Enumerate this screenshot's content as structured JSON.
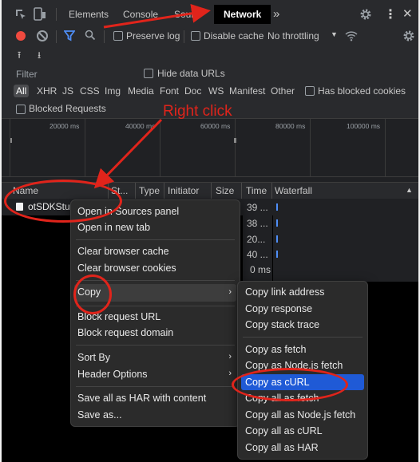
{
  "tabs": {
    "elements": "Elements",
    "console": "Console",
    "sources": "Sour",
    "network": "Network",
    "more": "»"
  },
  "toolbar": {
    "preserve_log": "Preserve log",
    "disable_cache": "Disable cache",
    "throttling": "No throttling"
  },
  "filter": {
    "placeholder": "Filter",
    "hide_data_urls": "Hide data URLs",
    "types": [
      "All",
      "XHR",
      "JS",
      "CSS",
      "Img",
      "Media",
      "Font",
      "Doc",
      "WS",
      "Manifest",
      "Other"
    ],
    "has_blocked_cookies": "Has blocked cookies",
    "blocked_requests": "Blocked Requests"
  },
  "timeline": {
    "ticks": [
      "20000 ms",
      "40000 ms",
      "60000 ms",
      "80000 ms",
      "100000 ms"
    ]
  },
  "table": {
    "headers": {
      "name": "Name",
      "status": "St...",
      "type": "Type",
      "initiator": "Initiator",
      "size": "Size",
      "time": "Time",
      "waterfall": "Waterfall"
    },
    "row_name": "otSDKStu",
    "times": [
      "39 ...",
      "38 ...",
      "20...",
      "40 ...",
      "0 ms"
    ]
  },
  "annotation": {
    "right_click": "Right click"
  },
  "context_menu": {
    "open_sources": "Open in Sources panel",
    "open_new_tab": "Open in new tab",
    "clear_cache": "Clear browser cache",
    "clear_cookies": "Clear browser cookies",
    "copy": "Copy",
    "block_url": "Block request URL",
    "block_domain": "Block request domain",
    "sort_by": "Sort By",
    "header_options": "Header Options",
    "save_har": "Save all as HAR with content",
    "save_as": "Save as..."
  },
  "copy_submenu": {
    "copy_link": "Copy link address",
    "copy_response": "Copy response",
    "copy_stack": "Copy stack trace",
    "copy_fetch": "Copy as fetch",
    "copy_node_fetch": "Copy as Node.js fetch",
    "copy_curl": "Copy as cURL",
    "copy_all_fetch": "Copy all as fetch",
    "copy_all_node_fetch": "Copy all as Node.js fetch",
    "copy_all_curl": "Copy all as cURL",
    "copy_all_har": "Copy all as HAR"
  },
  "colors": {
    "record": "#f04a3f",
    "annotation": "#e0241b",
    "highlight": "#1f5ad6",
    "filter_blue": "#4f8ef7"
  }
}
